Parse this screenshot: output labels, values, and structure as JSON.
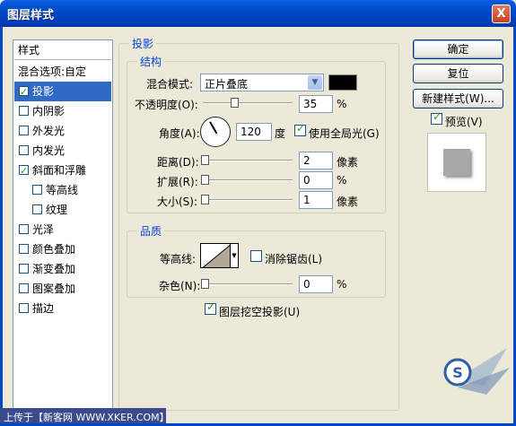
{
  "window": {
    "title": "图层样式",
    "close_label": "X"
  },
  "sidebar": {
    "header": "样式",
    "items": [
      {
        "label": "混合选项:自定",
        "checkbox": false,
        "indent": 0
      },
      {
        "label": "投影",
        "checkbox": true,
        "checked": true,
        "selected": true,
        "indent": 0
      },
      {
        "label": "内阴影",
        "checkbox": true,
        "checked": false,
        "indent": 0
      },
      {
        "label": "外发光",
        "checkbox": true,
        "checked": false,
        "indent": 0
      },
      {
        "label": "内发光",
        "checkbox": true,
        "checked": false,
        "indent": 0
      },
      {
        "label": "斜面和浮雕",
        "checkbox": true,
        "checked": true,
        "indent": 0
      },
      {
        "label": "等高线",
        "checkbox": true,
        "checked": false,
        "indent": 1
      },
      {
        "label": "纹理",
        "checkbox": true,
        "checked": false,
        "indent": 1
      },
      {
        "label": "光泽",
        "checkbox": true,
        "checked": false,
        "indent": 0
      },
      {
        "label": "颜色叠加",
        "checkbox": true,
        "checked": false,
        "indent": 0
      },
      {
        "label": "渐变叠加",
        "checkbox": true,
        "checked": false,
        "indent": 0
      },
      {
        "label": "图案叠加",
        "checkbox": true,
        "checked": false,
        "indent": 0
      },
      {
        "label": "描边",
        "checkbox": true,
        "checked": false,
        "indent": 0
      }
    ]
  },
  "main": {
    "section_title": "投影",
    "structure": {
      "title": "结构",
      "blend_mode_label": "混合模式:",
      "blend_mode_value": "正片叠底",
      "shadow_color": "#000000",
      "opacity_label": "不透明度(O):",
      "opacity_value": "35",
      "opacity_unit": "%",
      "opacity_fraction": 0.35,
      "angle_label": "角度(A):",
      "angle_value": "120",
      "angle_unit": "度",
      "global_light_label": "使用全局光(G)",
      "global_light_checked": true,
      "distance_label": "距离(D):",
      "distance_value": "2",
      "distance_unit": "像素",
      "spread_label": "扩展(R):",
      "spread_value": "0",
      "spread_unit": "%",
      "size_label": "大小(S):",
      "size_value": "1",
      "size_unit": "像素"
    },
    "quality": {
      "title": "品质",
      "contour_label": "等高线:",
      "antialias_label": "消除锯齿(L)",
      "antialias_checked": false,
      "noise_label": "杂色(N):",
      "noise_value": "0",
      "noise_unit": "%"
    },
    "knockout_label": "图层挖空投影(U)",
    "knockout_checked": true
  },
  "buttons": {
    "ok": "确定",
    "reset": "复位",
    "new_style": "新建样式(W)...",
    "preview_label": "预览(V)",
    "preview_checked": true
  },
  "watermark": {
    "left": "上传于【新客网 WWW.XKER.COM】"
  }
}
